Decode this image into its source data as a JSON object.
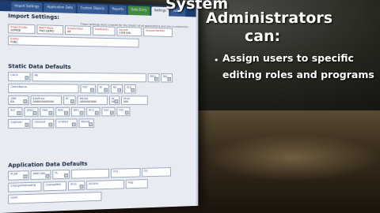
{
  "slide": {
    "title_line1": "System",
    "title_line2": "Administrators",
    "title_line3": "can:",
    "bullet_symbol": "•",
    "bullet_line1": "Assign users to specific",
    "bullet_line2": "editing roles and programs"
  },
  "screenshot": {
    "tabs": [
      {
        "label": "Import Settings"
      },
      {
        "label": "Application Data"
      },
      {
        "label": "Custom Objects"
      },
      {
        "label": "Reports"
      },
      {
        "label": "Data Entry",
        "green": true
      },
      {
        "label": "Settings",
        "active": true
      },
      {
        "label": "Admin"
      }
    ],
    "import_settings": {
      "heading": "Import Settings:",
      "note": "These settings were created for the import of all applications and are in production.",
      "row1": [
        {
          "label": "ProjectCode",
          "value": "SEMDB",
          "required": true
        },
        {
          "label": "BatchType",
          "value": "PHD DEMO",
          "required": true
        },
        {
          "label": "SessionYear",
          "value": "08",
          "required": true
        },
        {
          "label": "Institution",
          "value": "",
          "required": true
        },
        {
          "label": "Source",
          "value": "COM UNI",
          "required": true
        },
        {
          "label": "SessionSection",
          "value": "",
          "required": true
        }
      ],
      "row2": [
        {
          "label": "Entity",
          "value": "PUBL",
          "required": true
        }
      ]
    },
    "static_defaults": {
      "heading": "Static Data Defaults",
      "row1": [
        {
          "label": "CACE",
          "value": ""
        },
        {
          "label": "Nb",
          "value": ""
        },
        {
          "label": "BSCI",
          "value": ""
        },
        {
          "label": "BSC",
          "value": ""
        }
      ],
      "row2": [
        {
          "label": "ClientName",
          "value": ""
        },
        {
          "label": "FID",
          "value": ""
        },
        {
          "label": "RI",
          "value": ""
        },
        {
          "label": "NV",
          "value": ""
        },
        {
          "label": "OLE",
          "value": ""
        }
      ],
      "row3": [
        {
          "label": "OBE",
          "value": "EA"
        },
        {
          "label": "EmiPrice",
          "value": "000000000000"
        },
        {
          "label": "RI",
          "value": ""
        },
        {
          "label": "MEUM",
          "value": "0000000000"
        },
        {
          "label": "IN",
          "value": "00"
        },
        {
          "label": "PFUS",
          "value": "000"
        }
      ],
      "row4": [
        {
          "label": "PLT",
          "value": ""
        },
        {
          "label": "SPUC",
          "value": ""
        },
        {
          "label": "PMC",
          "value": ""
        },
        {
          "label": "RHC",
          "value": ""
        },
        {
          "label": "MFC",
          "value": ""
        },
        {
          "label": "RCC",
          "value": ""
        },
        {
          "label": "ESC",
          "value": ""
        },
        {
          "label": "FSC",
          "value": ""
        }
      ],
      "row5": [
        {
          "label": "CrgFlotn",
          "value": ""
        },
        {
          "label": "Uniofort",
          "value": ""
        },
        {
          "label": "Unitfort",
          "value": ""
        },
        {
          "label": "Marlot",
          "value": ""
        }
      ]
    },
    "application_defaults": {
      "heading": "Application Data Defaults",
      "row1": [
        {
          "label": "PLSN",
          "value": ""
        },
        {
          "label": "AddCode",
          "value": ""
        },
        {
          "label": "PL",
          "value": ""
        },
        {
          "label": "",
          "value": ""
        },
        {
          "label": "STS",
          "value": ""
        },
        {
          "label": "DC",
          "value": ""
        }
      ],
      "row2": [
        {
          "label": "ChangeMethodFlg",
          "value": ""
        },
        {
          "label": "ChangeMth",
          "value": ""
        },
        {
          "label": "Area",
          "value": ""
        },
        {
          "label": "Actions",
          "value": ""
        },
        {
          "label": "Flag",
          "value": ""
        }
      ],
      "row3": [
        {
          "label": "Load",
          "value": ""
        }
      ]
    }
  }
}
